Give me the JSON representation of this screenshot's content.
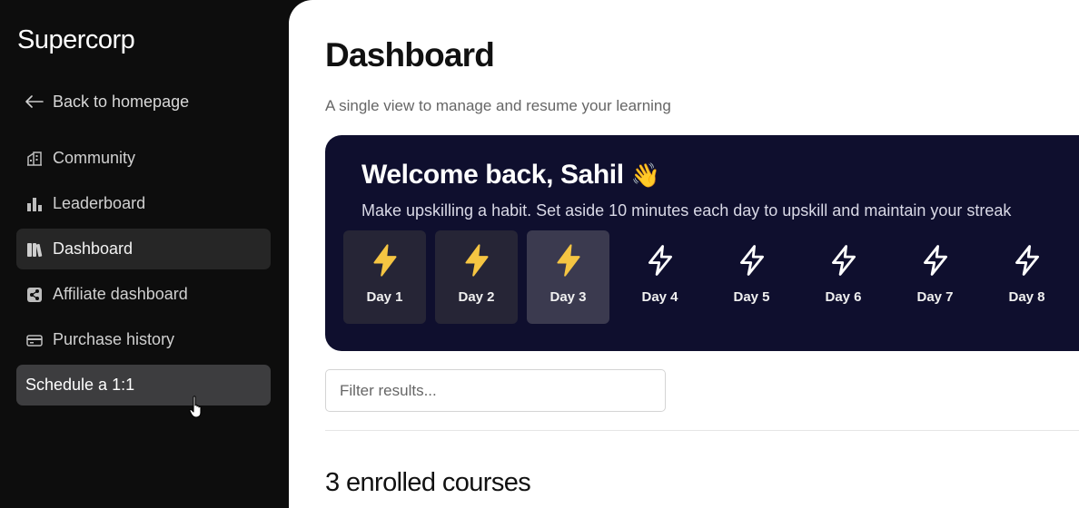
{
  "sidebar": {
    "brand": "Supercorp",
    "back_label": "Back to homepage",
    "items": [
      {
        "label": "Community",
        "icon": "building-icon"
      },
      {
        "label": "Leaderboard",
        "icon": "bar-chart-icon"
      },
      {
        "label": "Dashboard",
        "icon": "books-icon",
        "active": true
      },
      {
        "label": "Affiliate dashboard",
        "icon": "share-icon"
      },
      {
        "label": "Purchase history",
        "icon": "credit-card-icon"
      }
    ],
    "schedule_label": "Schedule a 1:1"
  },
  "main": {
    "title": "Dashboard",
    "subtitle": "A single view to manage and resume your learning",
    "streak": {
      "welcome": "Welcome back, Sahil",
      "wave_emoji": "👋",
      "description": "Make upskilling a habit. Set aside 10 minutes each day to upskill and maintain your streak",
      "days": [
        {
          "label": "Day 1",
          "state": "done"
        },
        {
          "label": "Day 2",
          "state": "done"
        },
        {
          "label": "Day 3",
          "state": "current"
        },
        {
          "label": "Day 4",
          "state": "pending"
        },
        {
          "label": "Day 5",
          "state": "pending"
        },
        {
          "label": "Day 6",
          "state": "pending"
        },
        {
          "label": "Day 7",
          "state": "pending"
        },
        {
          "label": "Day 8",
          "state": "pending"
        }
      ]
    },
    "filter": {
      "placeholder": "Filter results..."
    },
    "courses_title": "3 enrolled courses"
  },
  "colors": {
    "sidebar_bg": "#0d0d0d",
    "card_bg": "#0f0f2e",
    "bolt_filled": "#f5c542",
    "active_item_bg": "#262626",
    "schedule_bg": "#3d3d3f"
  }
}
